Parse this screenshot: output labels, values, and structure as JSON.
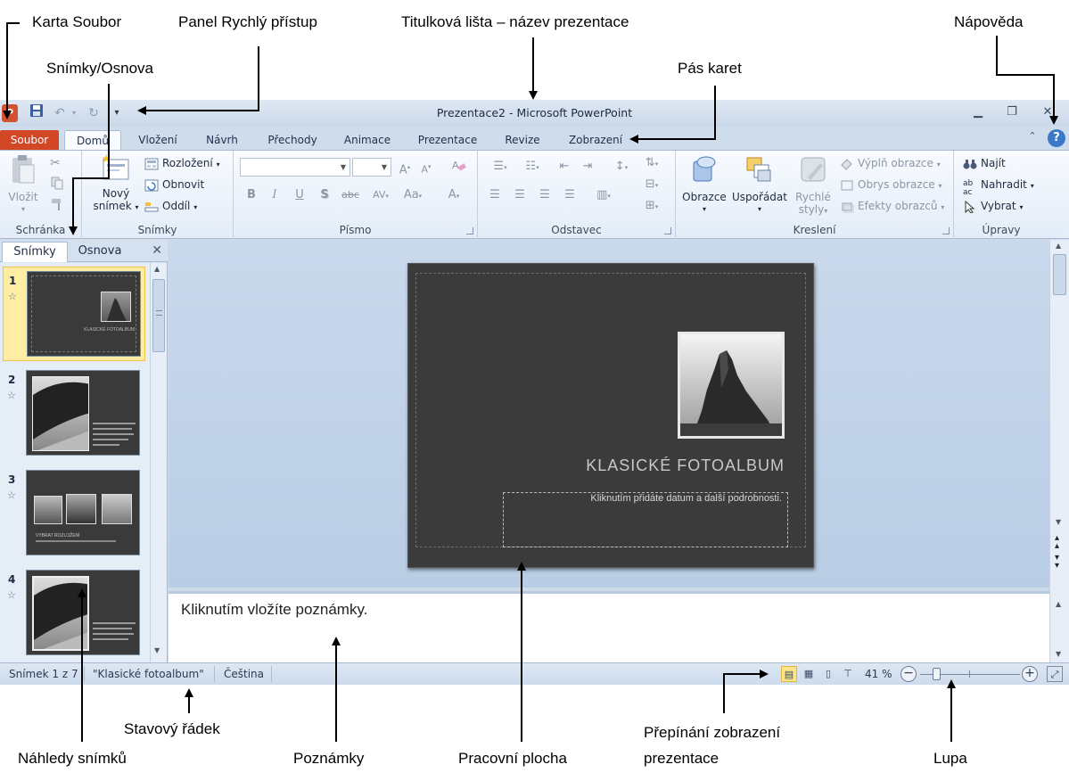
{
  "callouts": {
    "file_tab": "Karta Soubor",
    "quick_access": "Panel Rychlý přístup",
    "title_bar": "Titulková lišta – název prezentace",
    "help": "Nápověda",
    "slides_outline": "Snímky/Osnova",
    "ribbon": "Pás karet",
    "thumbnails": "Náhledy snímků",
    "status_bar": "Stavový řádek",
    "notes": "Poznámky",
    "workspace": "Pracovní plocha",
    "view_switch_line1": "Přepínání zobrazení",
    "view_switch_line2": "prezentace",
    "zoom": "Lupa"
  },
  "window": {
    "title": "Prezentace2  -  Microsoft PowerPoint"
  },
  "tabs": {
    "file": "Soubor",
    "items": [
      "Domů",
      "Vložení",
      "Návrh",
      "Přechody",
      "Animace",
      "Prezentace",
      "Revize",
      "Zobrazení"
    ],
    "active": "Domů"
  },
  "ribbon": {
    "clipboard": {
      "label": "Schránka",
      "paste": "Vložit"
    },
    "slides": {
      "label": "Snímky",
      "new_slide_line1": "Nový",
      "new_slide_line2": "snímek",
      "layout": "Rozložení",
      "reset": "Obnovit",
      "section": "Oddíl"
    },
    "font": {
      "label": "Písmo",
      "bold": "B",
      "italic": "I",
      "underline": "U",
      "shadow": "S",
      "strike": "abc",
      "spacing": "AV",
      "case": "Aa",
      "color": "A"
    },
    "paragraph": {
      "label": "Odstavec"
    },
    "drawing": {
      "label": "Kreslení",
      "shapes": "Obrazce",
      "arrange": "Uspořádat",
      "quick_styles_line1": "Rychlé",
      "quick_styles_line2": "styly",
      "fill": "Výplň obrazce",
      "outline": "Obrys obrazce",
      "effects": "Efekty obrazců"
    },
    "editing": {
      "label": "Úpravy",
      "find": "Najít",
      "replace": "Nahradit",
      "select": "Vybrat"
    }
  },
  "left_panel": {
    "tab_slides": "Snímky",
    "tab_outline": "Osnova",
    "thumbnails": [
      {
        "number": "1",
        "caption": "KLASICKÉ FOTOALBUM"
      },
      {
        "number": "2",
        "caption": ""
      },
      {
        "number": "3",
        "caption": "VYBRAT ROZLOŽENÍ"
      },
      {
        "number": "4",
        "caption": ""
      }
    ]
  },
  "slide": {
    "title": "KLASICKÉ  FOTOALBUM",
    "subtitle": "Kliknutím přidáte datum a další podrobnosti."
  },
  "notes": {
    "placeholder": "Kliknutím vložíte poznámky."
  },
  "status": {
    "slide_info": "Snímek 1 z 7",
    "theme": "\"Klasické fotoalbum\"",
    "language": "Čeština",
    "zoom": "41 %",
    "zoom_level": 0.41
  }
}
